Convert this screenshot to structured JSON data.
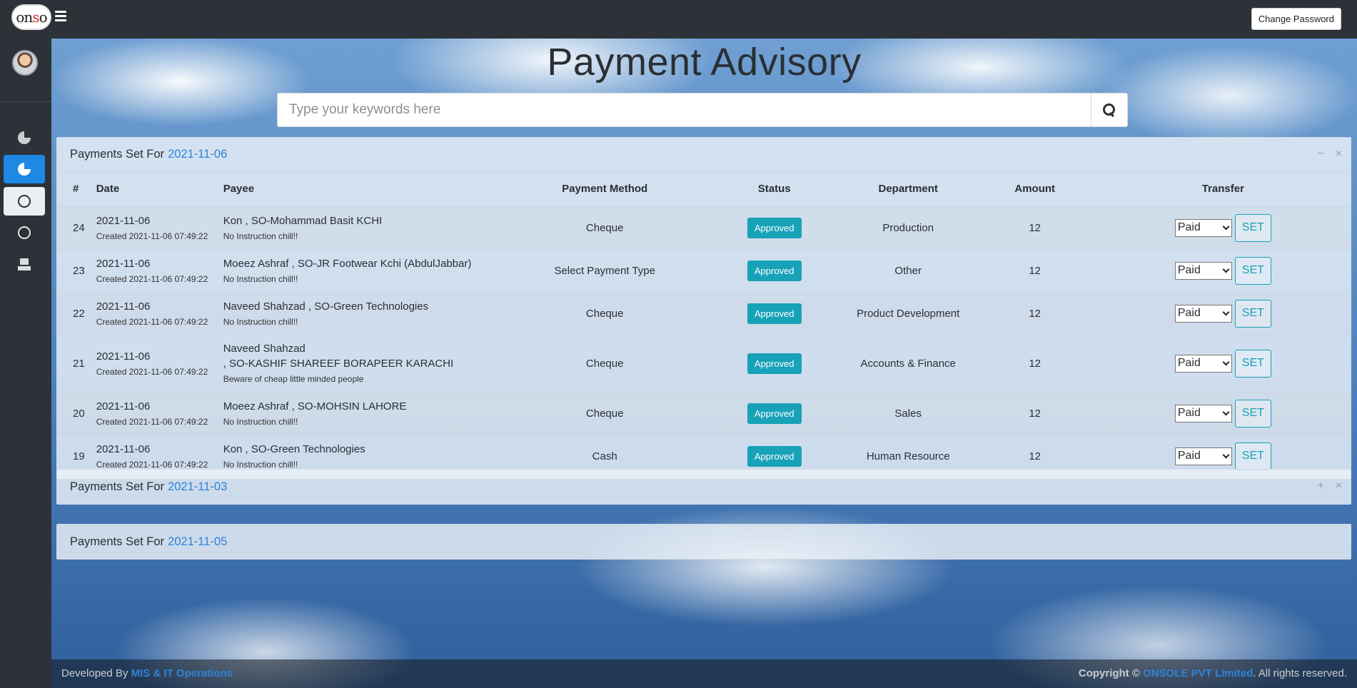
{
  "header": {
    "logo_text": "onsole",
    "change_password_label": "Change Password"
  },
  "page": {
    "title": "Payment Advisory",
    "search_placeholder": "Type your keywords here"
  },
  "sidebar": {
    "items": [
      {
        "icon": "pie-chart-icon"
      },
      {
        "icon": "pie-chart-icon",
        "active": true
      },
      {
        "icon": "circle-icon"
      },
      {
        "icon": "circle-icon"
      },
      {
        "icon": "inbox-tray-icon"
      }
    ]
  },
  "panels": [
    {
      "prefix": "Payments Set For",
      "date": "2021-11-06",
      "tools": [
        "−",
        "×"
      ],
      "columns": [
        "#",
        "Date",
        "Payee",
        "Payment Method",
        "Status",
        "Department",
        "Amount",
        "Transfer"
      ],
      "rows": [
        {
          "num": "24",
          "date": "2021-11-06",
          "created": "Created 2021-11-06 07:49:22",
          "payee": "Kon , SO-Mohammad Basit KCHI",
          "payee2": "",
          "note": "No Instruction chill!!",
          "method": "Cheque",
          "status": "Approved",
          "department": "Production",
          "amount": "12",
          "transfer": "Paid",
          "set": "SET"
        },
        {
          "num": "23",
          "date": "2021-11-06",
          "created": "Created 2021-11-06 07:49:22",
          "payee": "Moeez Ashraf , SO-JR Footwear Kchi (AbdulJabbar)",
          "payee2": "",
          "note": "No Instruction chill!!",
          "method": "Select Payment Type",
          "status": "Approved",
          "department": "Other",
          "amount": "12",
          "transfer": "Paid",
          "set": "SET"
        },
        {
          "num": "22",
          "date": "2021-11-06",
          "created": "Created 2021-11-06 07:49:22",
          "payee": "Naveed Shahzad , SO-Green Technologies",
          "payee2": "",
          "note": "No Instruction chill!!",
          "method": "Cheque",
          "status": "Approved",
          "department": "Product Development",
          "amount": "12",
          "transfer": "Paid",
          "set": "SET"
        },
        {
          "num": "21",
          "date": "2021-11-06",
          "created": "Created 2021-11-06 07:49:22",
          "payee": "Naveed Shahzad",
          "payee2": ", SO-KASHIF SHAREEF BORAPEER KARACHI",
          "note": "Beware of cheap little minded people",
          "method": "Cheque",
          "status": "Approved",
          "department": "Accounts & Finance",
          "amount": "12",
          "transfer": "Paid",
          "set": "SET"
        },
        {
          "num": "20",
          "date": "2021-11-06",
          "created": "Created 2021-11-06 07:49:22",
          "payee": "Moeez Ashraf , SO-MOHSIN LAHORE",
          "payee2": "",
          "note": "No Instruction chill!!",
          "method": "Cheque",
          "status": "Approved",
          "department": "Sales",
          "amount": "12",
          "transfer": "Paid",
          "set": "SET"
        },
        {
          "num": "19",
          "date": "2021-11-06",
          "created": "Created 2021-11-06 07:49:22",
          "payee": "Kon , SO-Green Technologies",
          "payee2": "",
          "note": "No Instruction chill!!",
          "method": "Cash",
          "status": "Approved",
          "department": "Human Resource",
          "amount": "12",
          "transfer": "Paid",
          "set": "SET"
        }
      ]
    },
    {
      "prefix": "Payments Set For",
      "date": "2021-11-03",
      "tools": [
        "+",
        "×"
      ]
    },
    {
      "prefix": "Payments Set For",
      "date": "2021-11-05",
      "tools": [
        "+",
        "×"
      ]
    }
  ],
  "footer": {
    "developed_by": "Developed By",
    "developer": "MIS & IT Operations",
    "copyright": "Copyright ©",
    "company": "ONSOLE PVT Limited",
    "rights": ". All rights reserved."
  },
  "colors": {
    "accent": "#1e88e5",
    "status_badge": "#17a2b8",
    "link": "#2f83d8"
  }
}
